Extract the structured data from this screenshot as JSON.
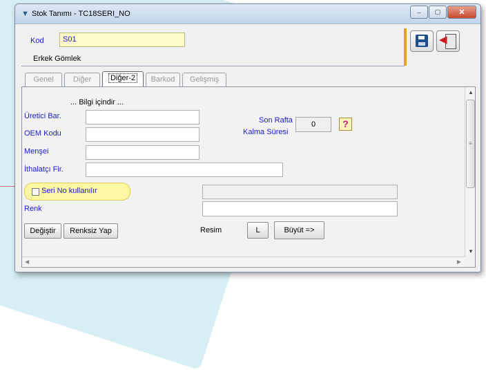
{
  "window": {
    "title": "Stok Tanımı - TC18SERI_NO",
    "minimize_glyph": "–",
    "maximize_glyph": "▢",
    "close_glyph": "✕"
  },
  "header": {
    "kod_label": "Kod",
    "kod_value": "S01",
    "product_name": "Erkek Gömlek"
  },
  "tabs": [
    "Genel",
    "Diğer",
    "Diğer-2",
    "Barkod",
    "Gelişmiş"
  ],
  "active_tab": "Diğer-2",
  "form": {
    "info_text": "... Bilgi içindir ...",
    "ureticibar_label": "Üretici Bar.",
    "oem_label": "OEM Kodu",
    "mensei_label": "Menşei",
    "ithalatci_label": "İthalatçı Fir.",
    "son_rafta_label": "Son Rafta",
    "kalma_suresi_label": "Kalma Süresi",
    "son_rafta_value": "0",
    "help_glyph": "?",
    "seri_no_label": "Seri No kullanılır",
    "renk_label": "Renk",
    "degistir_button": "Değiştir",
    "renksiz_button": "Renksiz Yap",
    "resim_label": "Resim",
    "l_button": "L",
    "buyut_button": "Büyüt =>"
  },
  "colors": {
    "label_blue": "#1a1acc",
    "highlight_yellow": "#fbf7a2",
    "code_field_yellow": "#fffbc8",
    "accent_orange": "#e8a21c",
    "help_magenta": "#c0187e"
  },
  "icons": {
    "app": "app-logo-icon",
    "save": "floppy-disk-icon",
    "exit": "exit-door-icon"
  }
}
